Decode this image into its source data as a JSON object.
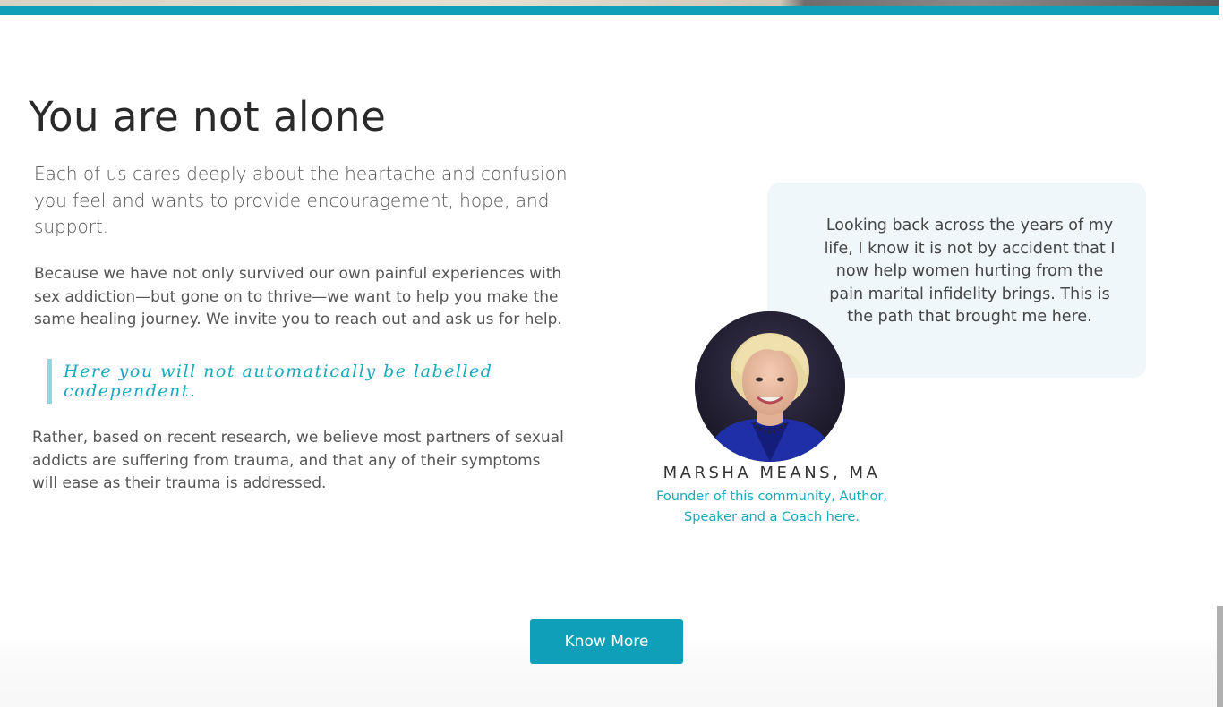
{
  "section": {
    "heading": "You are not alone",
    "lead": "Each of us cares deeply about the heartache and confusion you feel and wants to provide encouragement, hope, and support.",
    "paragraph": "Because we have not only survived our own painful experiences with sex addiction—but gone on to thrive—we want to help you make the same healing journey. We invite you to reach out and ask us for help.",
    "quote": "Here you will not automatically be labelled codependent.",
    "paragraph2": "Rather, based on recent research, we believe most partners of sexual addicts are suffering from trauma, and that any of their symptoms will ease as their trauma is addressed."
  },
  "testimonial": {
    "quote": "Looking back across the years of my life, I know it is not by accident that I now help women hurting from the pain marital infidelity brings. This is the path that brought me here.",
    "author_name": "MARSHA MEANS, MA",
    "author_role": "Founder of this community, Author, Speaker and a Coach here."
  },
  "cta": {
    "label": "Know More"
  },
  "colors": {
    "accent": "#0f9fb8",
    "quote_text": "#1aa8bd",
    "bubble_bg": "#eff7fa"
  }
}
